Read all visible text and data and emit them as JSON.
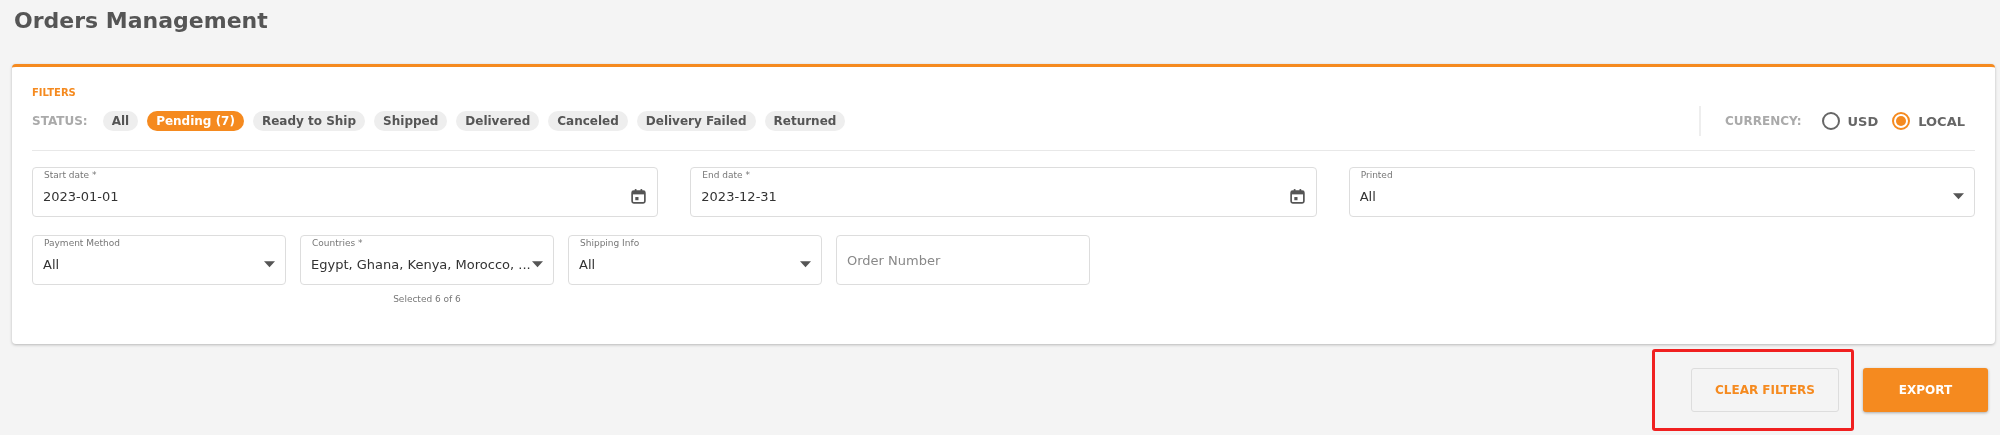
{
  "page_title": "Orders Management",
  "filters": {
    "heading": "FILTERS",
    "status_label": "STATUS:",
    "statuses": [
      {
        "label": "All",
        "selected": false
      },
      {
        "label": "Pending (7)",
        "selected": true
      },
      {
        "label": "Ready to Ship",
        "selected": false
      },
      {
        "label": "Shipped",
        "selected": false
      },
      {
        "label": "Delivered",
        "selected": false
      },
      {
        "label": "Canceled",
        "selected": false
      },
      {
        "label": "Delivery Failed",
        "selected": false
      },
      {
        "label": "Returned",
        "selected": false
      }
    ],
    "currency": {
      "label": "CURRENCY:",
      "options": [
        {
          "label": "USD",
          "selected": false
        },
        {
          "label": "LOCAL",
          "selected": true
        }
      ]
    },
    "row_1": [
      {
        "kind": "date",
        "label": "Start date *",
        "value": "2023-01-01"
      },
      {
        "kind": "date",
        "label": "End date *",
        "value": "2023-12-31"
      },
      {
        "kind": "select",
        "label": "Printed",
        "value": "All"
      }
    ],
    "row_2": [
      {
        "kind": "select",
        "label": "Payment Method",
        "value": "All"
      },
      {
        "kind": "select",
        "label": "Countries *",
        "value": "Egypt, Ghana, Kenya, Morocco, ...",
        "helper": "Selected 6 of 6"
      },
      {
        "kind": "select",
        "label": "Shipping Info",
        "value": "All"
      },
      {
        "kind": "text",
        "placeholder": "Order Number"
      }
    ]
  },
  "actions": [
    {
      "label": "CLEAR FILTERS",
      "kind": "outlined",
      "highlighted": true
    },
    {
      "label": "EXPORT",
      "kind": "filled",
      "highlighted": false
    }
  ]
}
